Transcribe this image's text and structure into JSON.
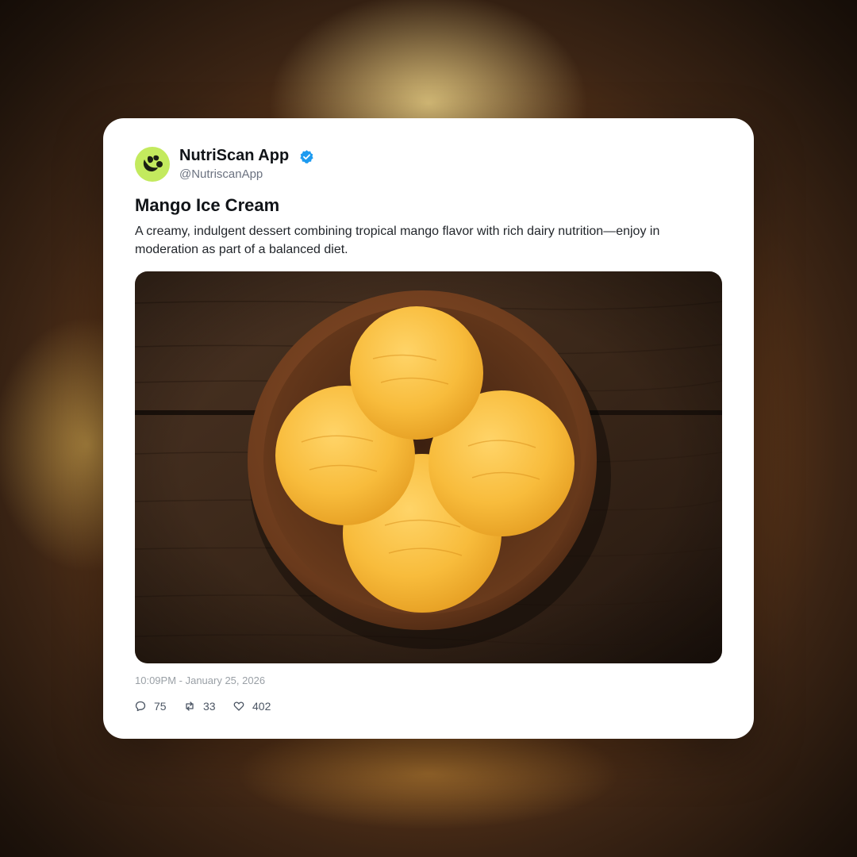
{
  "post": {
    "author": {
      "name": "NutriScan App",
      "handle": "@NutriscanApp",
      "verified": true,
      "avatar_icon": "leaf-logo-icon",
      "avatar_color": "#c3ea5e"
    },
    "title": "Mango Ice Cream",
    "body": "A creamy, indulgent dessert combining tropical mango flavor with rich dairy nutrition—enjoy in moderation as part of a balanced diet.",
    "image": {
      "subject": "mango-ice-cream-bowl-photo"
    },
    "timestamp": "10:09PM - January 25, 2026",
    "stats": {
      "replies": "75",
      "reposts": "33",
      "likes": "402"
    }
  },
  "colors": {
    "verified_badge": "#1d9bf0",
    "card_background": "#ffffff",
    "text_primary": "#111418",
    "text_secondary": "#6b7280"
  }
}
